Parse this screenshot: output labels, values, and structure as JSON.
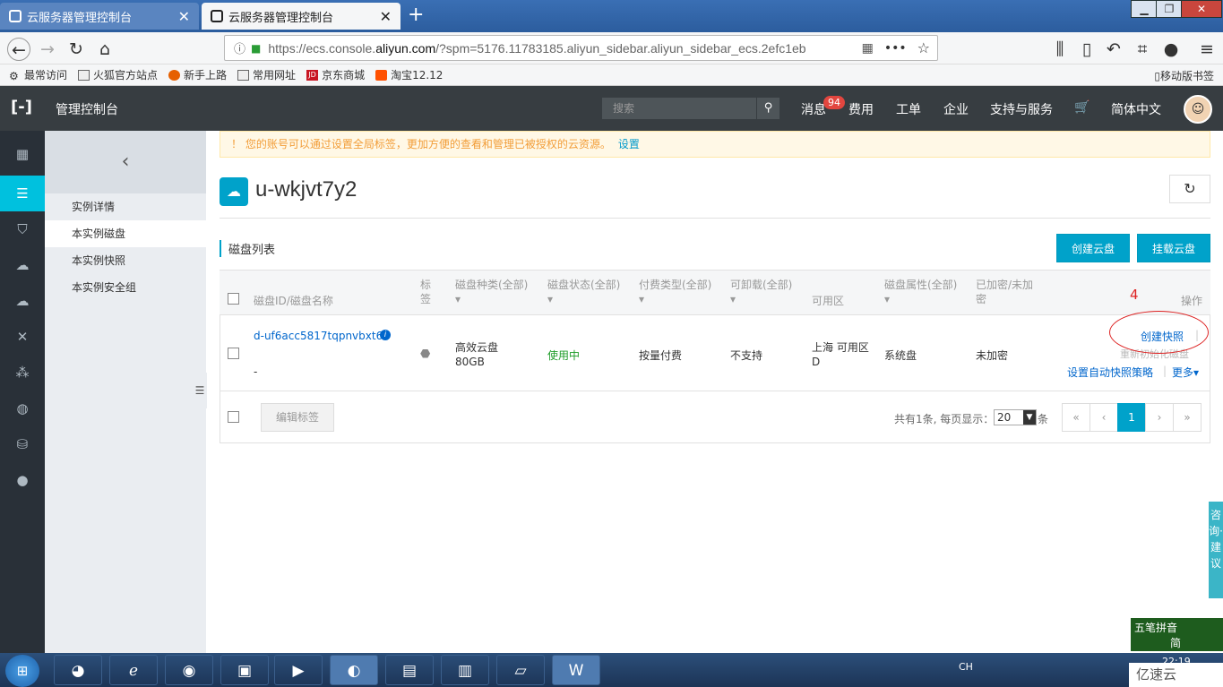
{
  "browser": {
    "tabs": [
      {
        "title": "云服务器管理控制台"
      },
      {
        "title": "云服务器管理控制台"
      }
    ],
    "url_prefix": "https://ecs.console.",
    "url_domain": "aliyun.com",
    "url_rest": "/?spm=5176.11783185.aliyun_sidebar.aliyun_sidebar_ecs.2efc1eb",
    "bookmarks": [
      "最常访问",
      "火狐官方站点",
      "新手上路",
      "常用网址",
      "京东商城",
      "淘宝12.12"
    ],
    "mobile_bookmarks": "移动版书签"
  },
  "header": {
    "title": "管理控制台",
    "search_placeholder": "搜索",
    "nav": [
      "消息",
      "费用",
      "工单",
      "企业",
      "支持与服务",
      "简体中文"
    ],
    "message_count": "94"
  },
  "submenu": {
    "items": [
      "实例详情",
      "本实例磁盘",
      "本实例快照",
      "本实例安全组"
    ]
  },
  "notice": {
    "text": "！ 您的账号可以通过设置全局标签，更加方便的查看和管理已被授权的云资源。",
    "link": "设置"
  },
  "instance": {
    "name": "u-wkjvt7y2"
  },
  "section": {
    "title": "磁盘列表",
    "create_button": "创建云盘",
    "attach_button": "挂载云盘"
  },
  "table": {
    "headers": {
      "id": "磁盘ID/磁盘名称",
      "tag1": "标",
      "tag2": "签",
      "type": "磁盘种类(全部)",
      "status": "磁盘状态(全部)",
      "billing": "付费类型(全部)",
      "detach": "可卸载(全部)",
      "zone": "可用区",
      "attr": "磁盘属性(全部)",
      "enc1": "已加密/未加",
      "enc2": "密",
      "ops": "操作"
    },
    "row": {
      "id": "d-uf6acc5817tqpnvbxt6z",
      "name": "-",
      "type": "高效云盘",
      "size": "80GB",
      "status": "使用中",
      "billing": "按量付费",
      "detach": "不支持",
      "zone1": "上海 可用区",
      "zone2": "D",
      "attr": "系统盘",
      "enc": "未加密",
      "op_snapshot": "创建快照",
      "op_reinit": "重新初始化磁盘",
      "op_autopolicy": "设置自动快照策略",
      "op_more": "更多"
    },
    "edit_tag": "编辑标签",
    "summary": "共有1条, 每页显示：",
    "page_size": "20",
    "page_unit": "条",
    "pages": [
      "«",
      "‹",
      "1",
      "›",
      "»"
    ]
  },
  "annotation": "4",
  "consult": "咨询·建议",
  "ime": {
    "line1": "五笔拼音",
    "line2": "简"
  },
  "taskbar": {
    "clock": "22:19",
    "tray_lang": "CH"
  },
  "watermark": "亿速云"
}
